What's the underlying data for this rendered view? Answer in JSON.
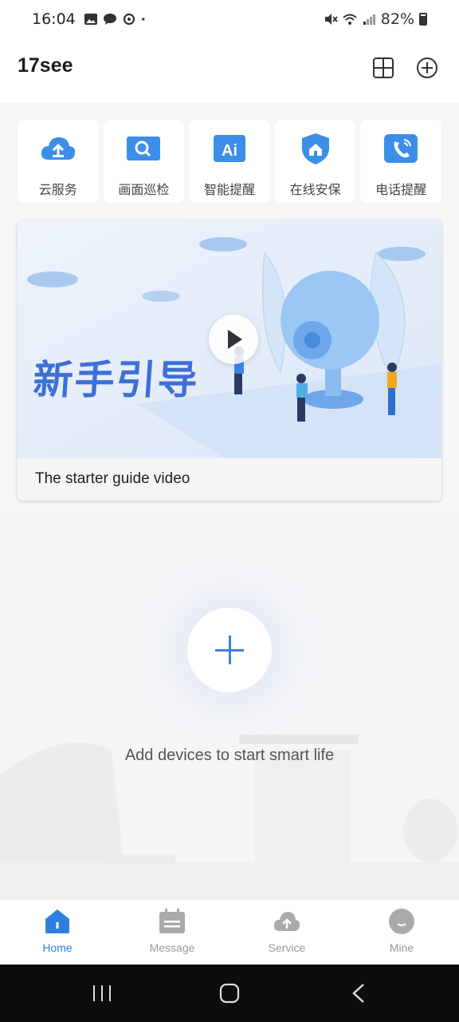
{
  "status_bar": {
    "time": "16:04",
    "battery": "82%",
    "left_icons": [
      "gallery-icon",
      "chat-bubble-icon",
      "sync-icon",
      "dot-icon"
    ],
    "right_icons": [
      "mute-icon",
      "wifi-icon",
      "signal-icon",
      "battery-icon"
    ]
  },
  "header": {
    "title": "17see",
    "actions": [
      "grid-view-icon",
      "add-circle-icon"
    ]
  },
  "services": [
    {
      "label": "云服务",
      "icon": "cloud-upload-icon"
    },
    {
      "label": "画面巡检",
      "icon": "inspection-icon"
    },
    {
      "label": "智能提醒",
      "icon": "ai-icon"
    },
    {
      "label": "在线安保",
      "icon": "shield-home-icon"
    },
    {
      "label": "电话提醒",
      "icon": "phone-call-icon"
    }
  ],
  "banner": {
    "headline": "新手引导",
    "caption": "The starter guide video"
  },
  "empty_state": {
    "message": "Add devices to start smart life"
  },
  "tabs": [
    {
      "label": "Home",
      "icon": "home-icon",
      "active": true
    },
    {
      "label": "Message",
      "icon": "calendar-message-icon",
      "active": false
    },
    {
      "label": "Service",
      "icon": "cloud-upload-icon",
      "active": false
    },
    {
      "label": "Mine",
      "icon": "profile-icon",
      "active": false
    }
  ],
  "colors": {
    "accent": "#2f7fe0",
    "icon_blue": "#3c8ee8",
    "inactive": "#999999"
  }
}
